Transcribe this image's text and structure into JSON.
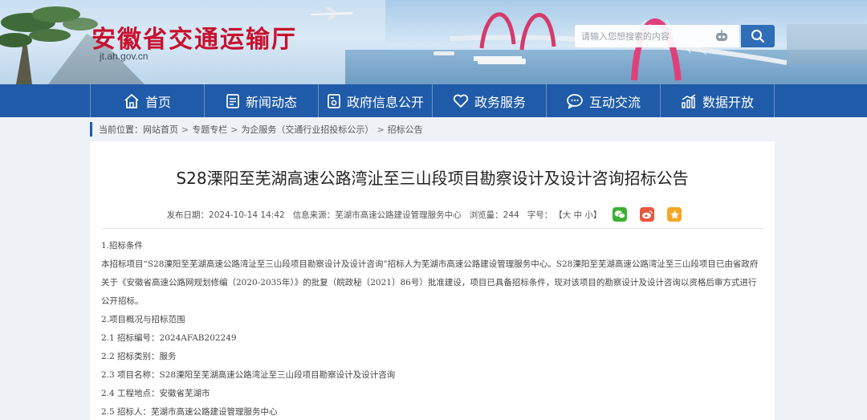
{
  "header": {
    "site_title": "安徽省交通运输厅",
    "site_url": "jt.ah.gov.cn",
    "search_placeholder": "请输入您想搜索的内容"
  },
  "nav": {
    "items": [
      {
        "label": "首页",
        "icon": "home-icon"
      },
      {
        "label": "新闻动态",
        "icon": "news-icon"
      },
      {
        "label": "政府信息公开",
        "icon": "document-icon"
      },
      {
        "label": "政务服务",
        "icon": "heart-icon"
      },
      {
        "label": "互动交流",
        "icon": "chat-icon"
      },
      {
        "label": "数据开放",
        "icon": "chart-icon"
      }
    ]
  },
  "breadcrumb": {
    "prefix": "当前位置：",
    "items": [
      "网站首页",
      "专题专栏",
      "为企服务（交通行业招投标公示）",
      "招标公告"
    ],
    "separator": ">"
  },
  "article": {
    "title": "S28溧阳至芜湖高速公路湾沚至三山段项目勘察设计及设计咨询招标公告",
    "meta": {
      "date": "发布日期：2024-10-14 14:42",
      "source": "信息来源：芜湖市高速公路建设管理服务中心",
      "views": "浏览量：244",
      "font_label": "字号：",
      "font_sizes": "【大 中 小】"
    },
    "share_icons": [
      "wechat-icon",
      "weibo-icon",
      "qzone-icon"
    ],
    "paragraphs": [
      "1.招标条件",
      "本招标项目“S28溧阳至芜湖高速公路湾沚至三山段项目勘察设计及设计咨询”招标人为芜湖市高速公路建设管理服务中心。S28溧阳至芜湖高速公路湾沚至三山段项目已由省政府关于《安徽省高速公路网规划修编（2020-2035年）》的批复（皖政秘〔2021〕86号）批准建设，项目已具备招标条件，现对该项目的勘察设计及设计咨询以资格后审方式进行公开招标。",
      "2.项目概况与招标范围",
      "2.1  招标编号：2024AFAB202249",
      "2.2 招标类别：服务",
      "2.3 项目名称：S28溧阳至芜湖高速公路湾沚至三山段项目勘察设计及设计咨询",
      "2.4 工程地点：安徽省芜湖市",
      "2.5 招标人：芜湖市高速公路建设管理服务中心"
    ]
  },
  "colors": {
    "nav_bg": "#1f5ba8",
    "title_red": "#c8102e",
    "search_btn": "#2f6db7"
  }
}
